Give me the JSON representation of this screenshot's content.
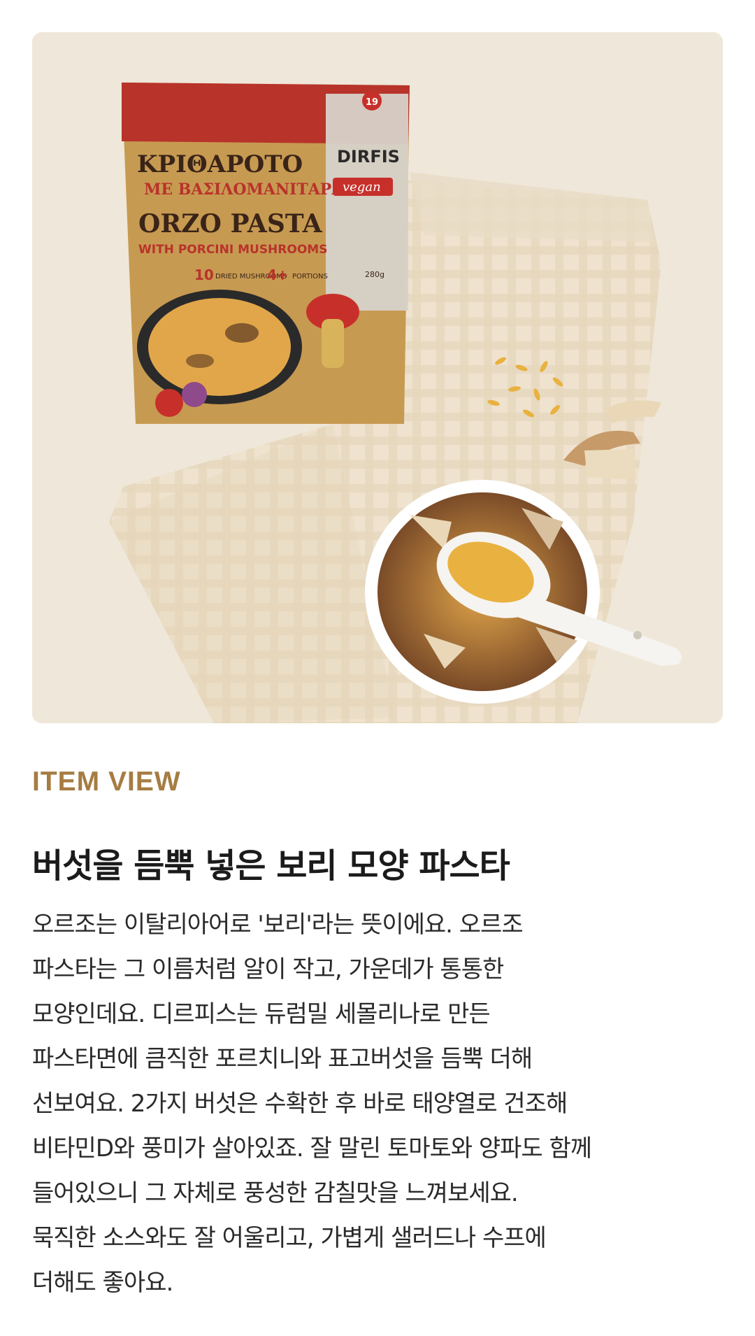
{
  "product_photo": {
    "package": {
      "title_greek_1": "ΚΡΙΘΑΡΟΤΟ",
      "title_greek_2": "ΜΕ ΒΑΣΙΛΟΜΑΝΙΤΑΡΑ",
      "title_en": "ORZO PASTA",
      "subtitle_en": "WITH PORCINI MUSHROOMS",
      "brand": "DIRFIS",
      "badge_vegan": "vegan",
      "badge_number": "19",
      "stat_1_value": "10",
      "stat_1_label": "DRIED MUSHROOMS",
      "stat_2_value": "4+",
      "stat_2_label": "PORTIONS",
      "weight": "280g"
    }
  },
  "section": {
    "eyebrow": "ITEM VIEW",
    "headline": "버섯을 듬뿍 넣은 보리 모양 파스타",
    "body_lines": [
      "오르조는 이탈리아어로 '보리'라는 뜻이에요. 오르조",
      "파스타는 그 이름처럼 알이 작고, 가운데가 통통한",
      "모양인데요. 디르피스는 듀럼밀 세몰리나로 만든",
      "파스타면에 큼직한 포르치니와 표고버섯을 듬뿍 더해",
      "선보여요. 2가지 버섯은 수확한 후 바로 태양열로 건조해",
      "비타민D와 풍미가 살아있죠. 잘 말린 토마토와 양파도 함께",
      "들어있으니 그 자체로 풍성한 감칠맛을 느껴보세요.",
      "묵직한 소스와도 잘 어울리고, 가볍게 샐러드나 수프에",
      "더해도 좋아요."
    ]
  },
  "colors": {
    "eyebrow": "#a67c42",
    "background_photo": "#efe7d9",
    "package_red": "#b8332a",
    "package_gold": "#c79a52"
  }
}
